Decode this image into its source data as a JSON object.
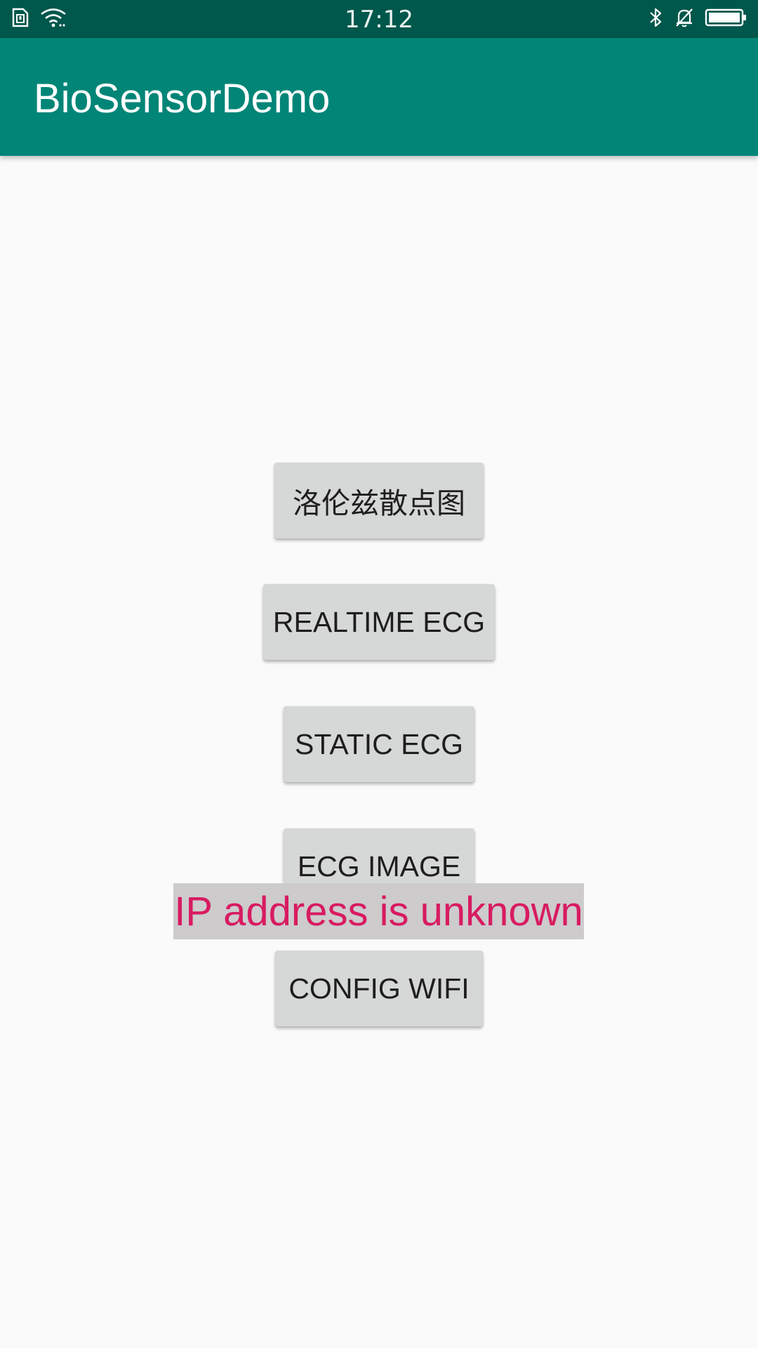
{
  "status_bar": {
    "time": "17:12",
    "icons_left": [
      "sim-card-icon",
      "wifi-icon"
    ],
    "icons_right": [
      "bluetooth-icon",
      "notifications-off-icon",
      "battery-icon"
    ]
  },
  "app_bar": {
    "title": "BioSensorDemo"
  },
  "buttons": [
    {
      "label": "洛伦兹散点图"
    },
    {
      "label": "REALTIME ECG"
    },
    {
      "label": "STATIC ECG"
    },
    {
      "label": "ECG IMAGE"
    },
    {
      "label": "CONFIG WIFI"
    }
  ],
  "ip_status": {
    "text": "IP address is unknown"
  },
  "colors": {
    "status_bar": "#00574b",
    "app_bar": "#008577",
    "button_bg": "#d6d7d7",
    "ip_text": "#d81b60",
    "ip_bg": "#cdcbcc"
  }
}
